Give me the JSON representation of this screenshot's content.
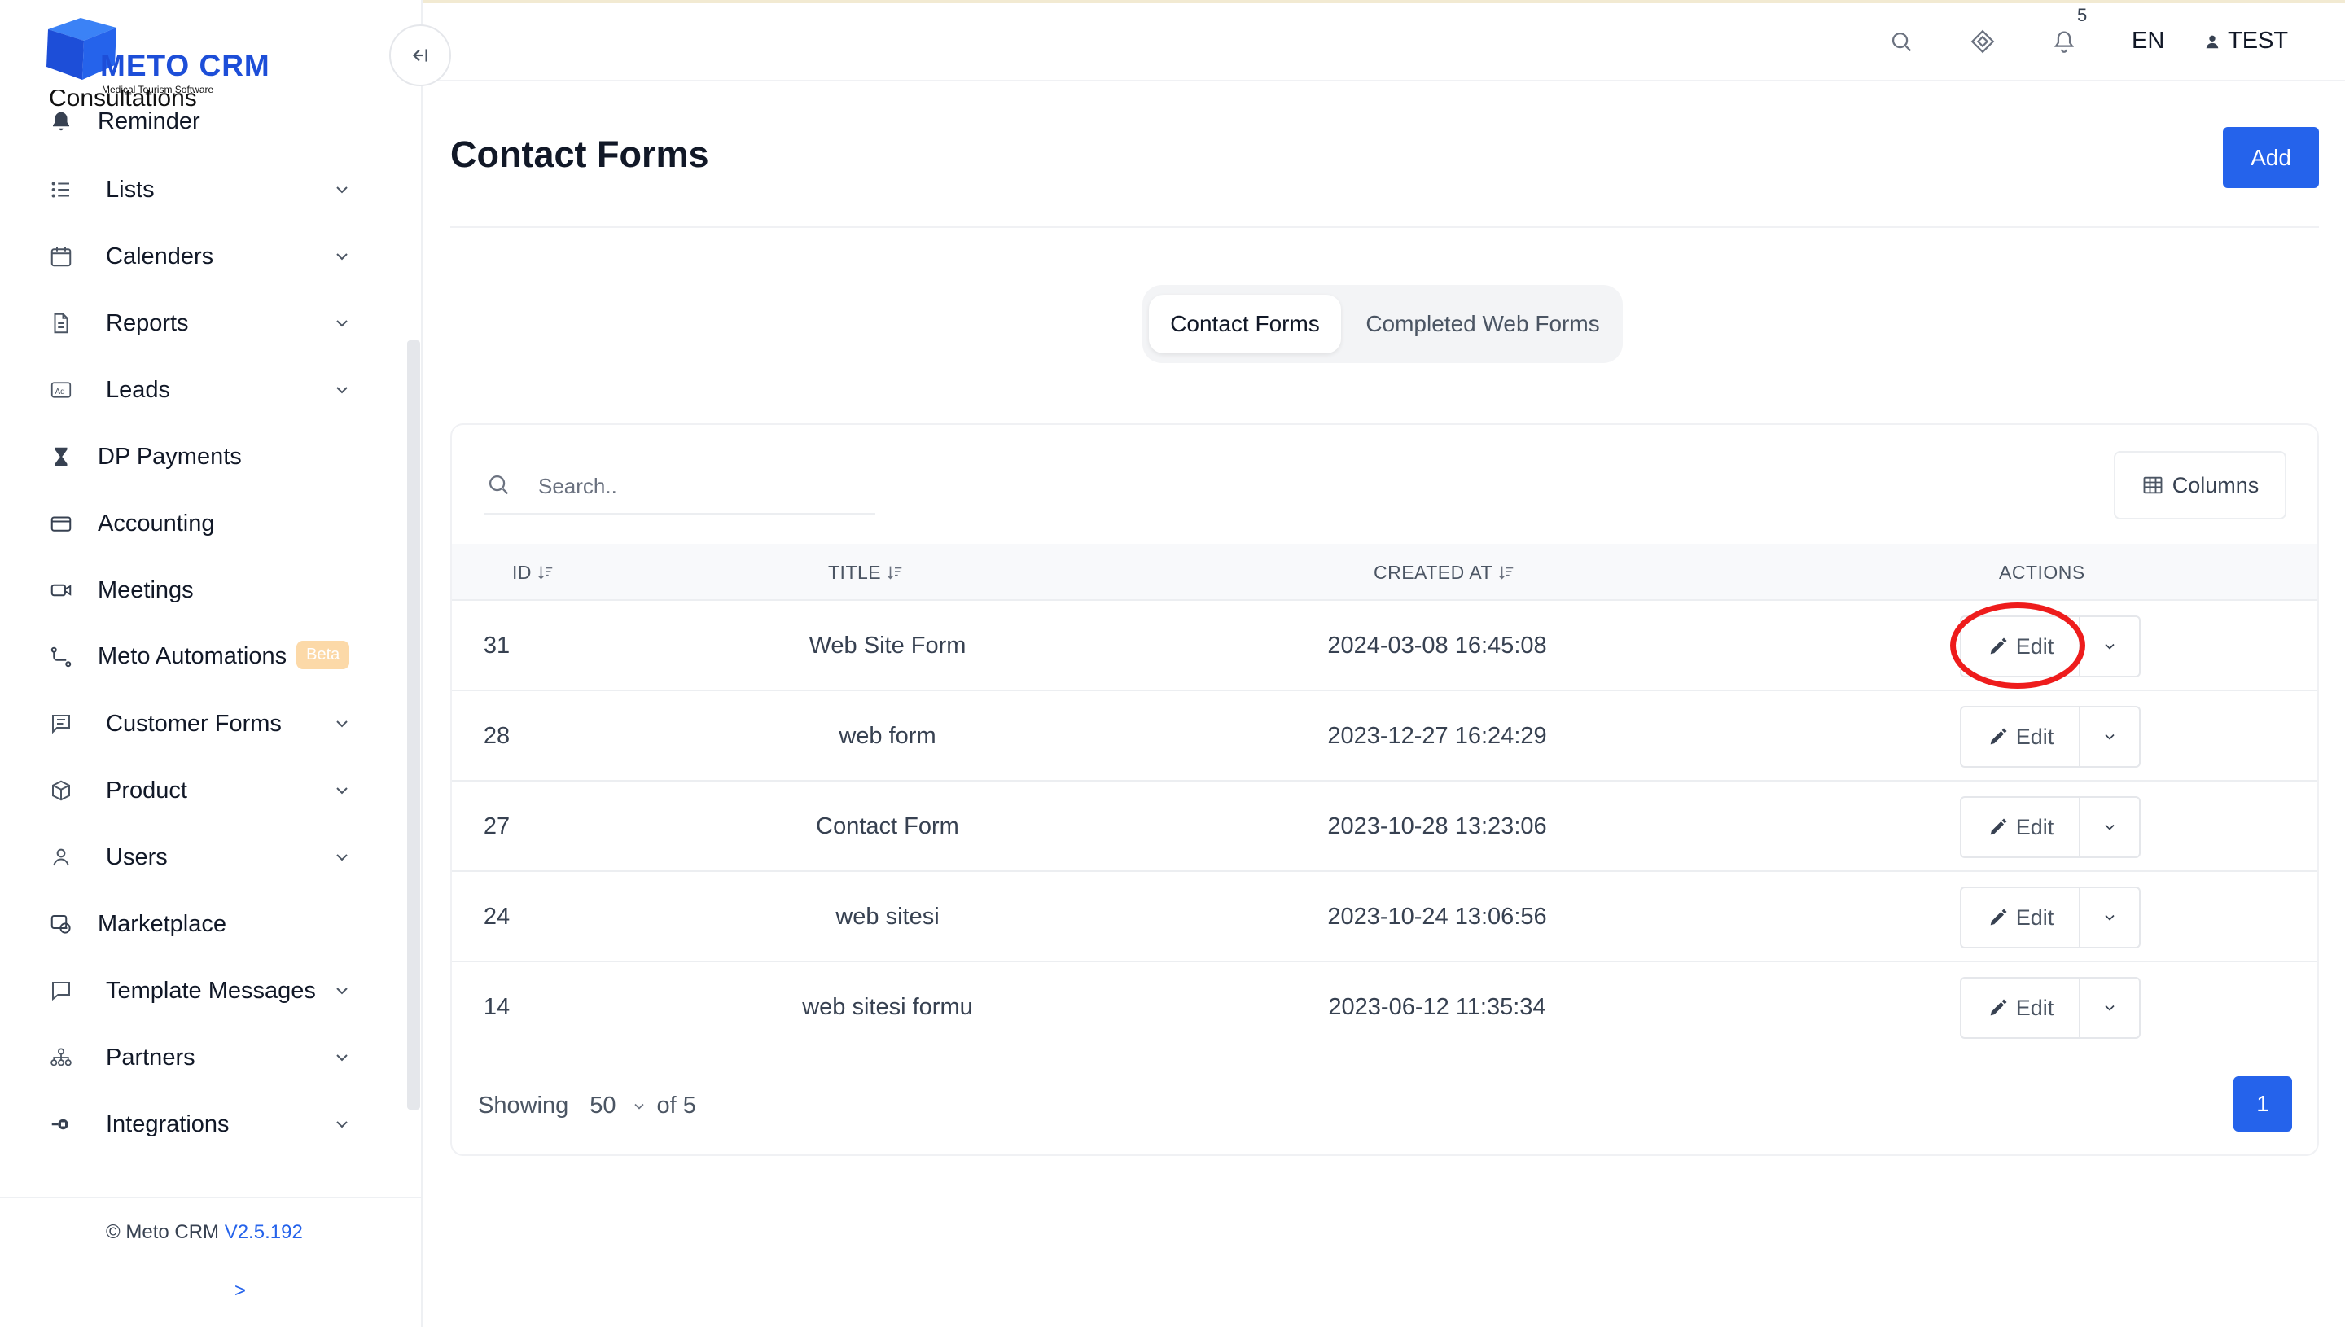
{
  "brand": {
    "name": "METO CRM",
    "tagline": "Medical Tourism Software",
    "color": "#1d4ed8"
  },
  "sidebar": {
    "partial_item": "Consultations",
    "items": [
      {
        "label": "Reminder",
        "icon": "bell-icon",
        "has_children": false
      },
      {
        "label": "Lists",
        "icon": "list-icon",
        "has_children": true
      },
      {
        "label": "Calenders",
        "icon": "calendar-icon",
        "has_children": true
      },
      {
        "label": "Reports",
        "icon": "document-icon",
        "has_children": true
      },
      {
        "label": "Leads",
        "icon": "ad-icon",
        "has_children": true
      },
      {
        "label": "DP Payments",
        "icon": "hourglass-icon",
        "has_children": false
      },
      {
        "label": "Accounting",
        "icon": "credit-card-icon",
        "has_children": false
      },
      {
        "label": "Meetings",
        "icon": "video-icon",
        "has_children": false
      },
      {
        "label": "Meto Automations",
        "icon": "flow-icon",
        "has_children": false,
        "badge": "Beta"
      },
      {
        "label": "Customer Forms",
        "icon": "form-icon",
        "has_children": true
      },
      {
        "label": "Product",
        "icon": "box-icon",
        "has_children": true
      },
      {
        "label": "Users",
        "icon": "user-icon",
        "has_children": true
      },
      {
        "label": "Marketplace",
        "icon": "marketplace-icon",
        "has_children": false
      },
      {
        "label": "Template Messages",
        "icon": "message-icon",
        "has_children": true
      },
      {
        "label": "Partners",
        "icon": "partners-icon",
        "has_children": true
      },
      {
        "label": "Integrations",
        "icon": "plug-icon",
        "has_children": true
      }
    ],
    "footer": {
      "copyright": "© Meto CRM",
      "version": "V2.5.192",
      "expand": ">"
    }
  },
  "topbar": {
    "notification_count": "5",
    "language": "EN",
    "user": "TEST"
  },
  "page": {
    "title": "Contact Forms",
    "add_label": "Add",
    "tabs": [
      {
        "label": "Contact Forms",
        "active": true
      },
      {
        "label": "Completed Web Forms",
        "active": false
      }
    ],
    "search_placeholder": "Search..",
    "columns_label": "Columns",
    "table": {
      "headers": {
        "id": "ID",
        "title": "TITLE",
        "created_at": "CREATED AT",
        "actions": "ACTIONS"
      },
      "rows": [
        {
          "id": "31",
          "title": "Web Site Form",
          "created_at": "2024-03-08 16:45:08",
          "action": "Edit"
        },
        {
          "id": "28",
          "title": "web form",
          "created_at": "2023-12-27 16:24:29",
          "action": "Edit"
        },
        {
          "id": "27",
          "title": "Contact Form",
          "created_at": "2023-10-28 13:23:06",
          "action": "Edit"
        },
        {
          "id": "24",
          "title": "web sitesi",
          "created_at": "2023-10-24 13:06:56",
          "action": "Edit"
        },
        {
          "id": "14",
          "title": "web sitesi formu",
          "created_at": "2023-06-12 11:35:34",
          "action": "Edit"
        }
      ]
    },
    "pagination": {
      "showing": "Showing",
      "page_size": "50",
      "of": "of 5",
      "current_page": "1"
    }
  },
  "colors": {
    "primary": "#2563eb",
    "highlight": "#ee1c1c",
    "beta": "#fcd9a8"
  }
}
